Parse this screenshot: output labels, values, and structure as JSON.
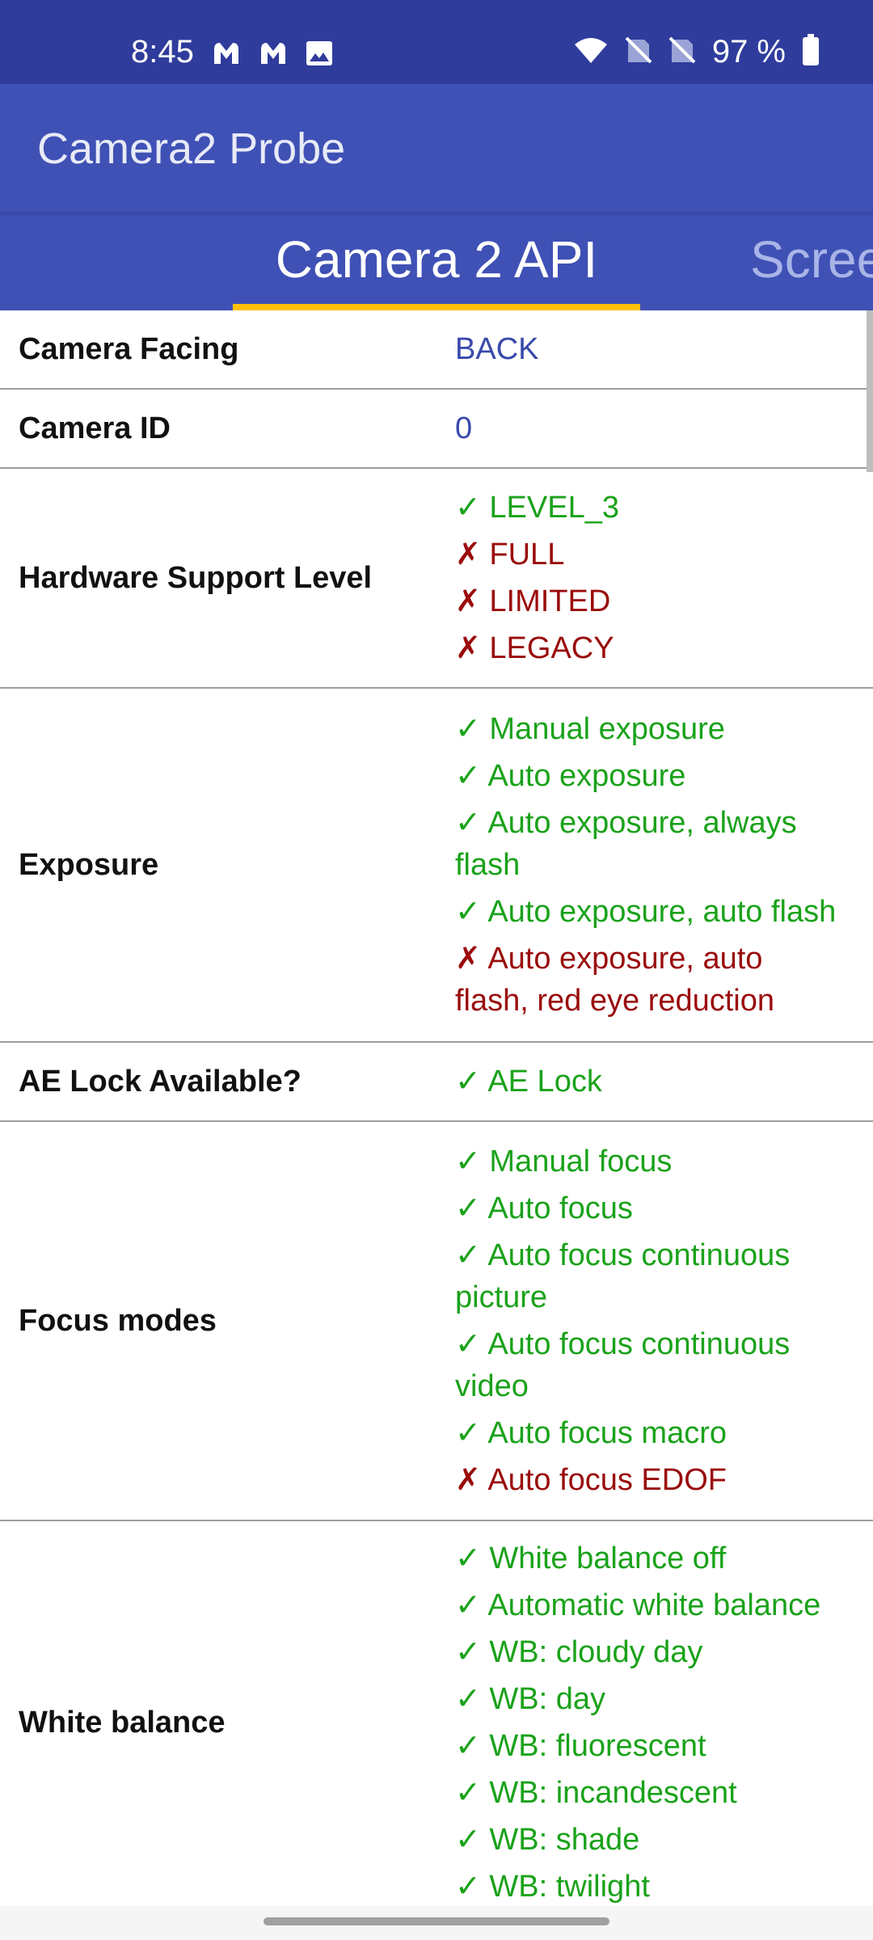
{
  "status_bar": {
    "time": "8:45",
    "left_icons": [
      "malwarebytes-icon",
      "malwarebytes-icon",
      "image-icon"
    ],
    "right_icons": [
      "wifi-icon",
      "no-sim-icon",
      "no-sim-icon"
    ],
    "battery_text": "97 %",
    "battery_icon": "battery-icon"
  },
  "app_bar": {
    "title": "Camera2 Probe"
  },
  "tabs": {
    "active": "Camera 2 API",
    "next": "Scree"
  },
  "colors": {
    "status_bar": "#2f3c9c",
    "app_bar": "#3f51b5",
    "indicator": "#ffc107",
    "supported": "#1aa21a",
    "unsupported": "#9a0b0b",
    "plain_value": "#3949ab"
  },
  "rows": [
    {
      "label": "Camera Facing",
      "value": "BACK"
    },
    {
      "label": "Camera ID",
      "value": "0"
    },
    {
      "label": "Hardware Support Level",
      "items": [
        {
          "mark": "✓",
          "text": "LEVEL_3",
          "supported": true
        },
        {
          "mark": "✗",
          "text": "FULL",
          "supported": false
        },
        {
          "mark": "✗",
          "text": "LIMITED",
          "supported": false
        },
        {
          "mark": "✗",
          "text": "LEGACY",
          "supported": false
        }
      ]
    },
    {
      "label": "Exposure",
      "items": [
        {
          "mark": "✓",
          "text": "Manual exposure",
          "supported": true
        },
        {
          "mark": "✓",
          "text": "Auto exposure",
          "supported": true
        },
        {
          "mark": "✓",
          "text": "Auto exposure, always flash",
          "supported": true
        },
        {
          "mark": "✓",
          "text": "Auto exposure, auto flash",
          "supported": true
        },
        {
          "mark": "✗",
          "text": "Auto exposure, auto flash, red eye reduction",
          "supported": false
        }
      ]
    },
    {
      "label": "AE Lock Available?",
      "items": [
        {
          "mark": "✓",
          "text": "AE Lock",
          "supported": true
        }
      ]
    },
    {
      "label": "Focus modes",
      "items": [
        {
          "mark": "✓",
          "text": "Manual focus",
          "supported": true
        },
        {
          "mark": "✓",
          "text": "Auto focus",
          "supported": true
        },
        {
          "mark": "✓",
          "text": "Auto focus continuous picture",
          "supported": true
        },
        {
          "mark": "✓",
          "text": "Auto focus continuous video",
          "supported": true
        },
        {
          "mark": "✓",
          "text": "Auto focus macro",
          "supported": true
        },
        {
          "mark": "✗",
          "text": "Auto focus EDOF",
          "supported": false
        }
      ]
    },
    {
      "label": "White balance",
      "items": [
        {
          "mark": "✓",
          "text": "White balance off",
          "supported": true
        },
        {
          "mark": "✓",
          "text": "Automatic white balance",
          "supported": true
        },
        {
          "mark": "✓",
          "text": "WB: cloudy day",
          "supported": true
        },
        {
          "mark": "✓",
          "text": "WB: day",
          "supported": true
        },
        {
          "mark": "✓",
          "text": "WB: fluorescent",
          "supported": true
        },
        {
          "mark": "✓",
          "text": "WB: incandescent",
          "supported": true
        },
        {
          "mark": "✓",
          "text": "WB: shade",
          "supported": true
        },
        {
          "mark": "✓",
          "text": "WB: twilight",
          "supported": true
        }
      ]
    }
  ]
}
